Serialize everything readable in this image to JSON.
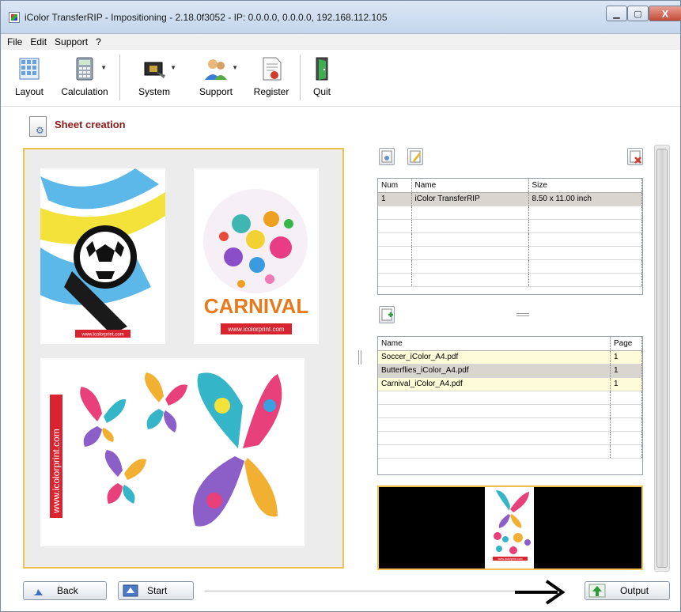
{
  "window": {
    "title": "iColor TransferRIP - Impositioning - 2.18.0f3052 - IP: 0.0.0.0, 0.0.0.0, 192.168.112.105",
    "min_label": "▁",
    "max_label": "▢",
    "close_label": "X"
  },
  "menu": [
    "File",
    "Edit",
    "Support",
    "?"
  ],
  "toolbar": {
    "layout": "Layout",
    "calculation": "Calculation",
    "system": "System",
    "support": "Support",
    "register": "Register",
    "quit": "Quit"
  },
  "section": {
    "title": "Sheet creation"
  },
  "sheet": {
    "soccer_url": "www.icolorprint.com",
    "carnival_word": "CARNIVAL",
    "carnival_url": "www.icolorprint.com",
    "butterflies_url": "www.icolorprint.com"
  },
  "media_table": {
    "headers": [
      "Num",
      "Name",
      "Size"
    ],
    "rows": [
      {
        "num": "1",
        "name": "iColor TransferRIP",
        "size": "8.50 x 11.00 inch"
      }
    ]
  },
  "files_table": {
    "headers": [
      "Name",
      "Page"
    ],
    "rows": [
      {
        "name": "Soccer_iColor_A4.pdf",
        "page": "1"
      },
      {
        "name": "Butterflies_iColor_A4.pdf",
        "page": "1"
      },
      {
        "name": "Carnival_iColor_A4.pdf",
        "page": "1"
      }
    ]
  },
  "preview": {
    "url": "www.icolorprint.com"
  },
  "buttons": {
    "back": "Back",
    "start": "Start",
    "output": "Output"
  },
  "colors": {
    "accent": "#f0c04a",
    "section_title": "#8b1a1a",
    "selected_row": "#d9d5cf",
    "file_row": "#fefbd8"
  }
}
